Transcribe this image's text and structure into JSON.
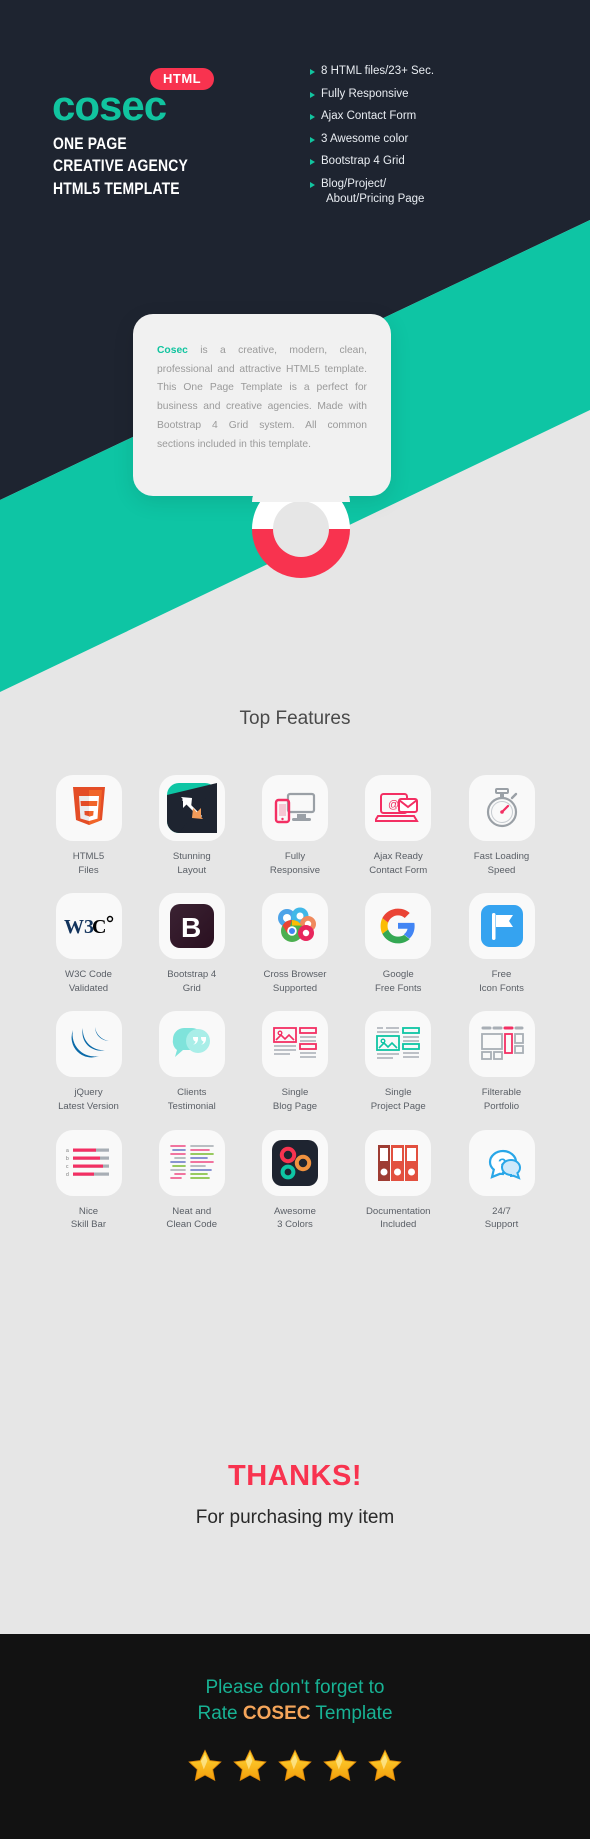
{
  "hero": {
    "badge": "HTML",
    "logo": "cosec",
    "title_lines": [
      "ONE PAGE",
      "CREATIVE AGENCY",
      "HTML5 TEMPLATE"
    ],
    "features": [
      {
        "text": "8 HTML files/23+ Sec.",
        "sub": ""
      },
      {
        "text": "Fully Responsive",
        "sub": ""
      },
      {
        "text": "Ajax Contact Form",
        "sub": ""
      },
      {
        "text": "3 Awesome color",
        "sub": ""
      },
      {
        "text": "Bootstrap 4 Grid",
        "sub": ""
      },
      {
        "text": "Blog/Project/",
        "sub": "About/Pricing Page"
      }
    ]
  },
  "description": {
    "brand": "Cosec",
    "body": " is a creative, modern, clean, professional and attractive HTML5 template. This One Page Template is a perfect for business and creative agencies. Made with Bootstrap 4 Grid system. All common sections included in this template."
  },
  "features_section": {
    "title": "Top Features",
    "rows": [
      [
        {
          "icon": "html5-icon",
          "label": "HTML5\nFiles"
        },
        {
          "icon": "stunning-layout-icon",
          "label": "Stunning\nLayout"
        },
        {
          "icon": "responsive-devices-icon",
          "label": "Fully\nResponsive"
        },
        {
          "icon": "ajax-contact-form-icon",
          "label": "Ajax Ready\nContact Form"
        },
        {
          "icon": "stopwatch-icon",
          "label": "Fast Loading\nSpeed"
        }
      ],
      [
        {
          "icon": "w3c-icon",
          "label": "W3C Code\nValidated"
        },
        {
          "icon": "bootstrap-icon",
          "label": "Bootstrap 4\nGrid"
        },
        {
          "icon": "browsers-icon",
          "label": "Cross Browser\nSupported"
        },
        {
          "icon": "google-icon",
          "label": "Google\nFree Fonts"
        },
        {
          "icon": "flag-icon",
          "label": "Free\nIcon Fonts"
        }
      ],
      [
        {
          "icon": "jquery-icon",
          "label": "jQuery\nLatest Version"
        },
        {
          "icon": "testimonial-chat-icon",
          "label": "Clients\nTestimonial"
        },
        {
          "icon": "blog-page-icon",
          "label": "Single\nBlog Page"
        },
        {
          "icon": "project-page-icon",
          "label": "Single\nProject Page"
        },
        {
          "icon": "portfolio-grid-icon",
          "label": "Filterable\nPortfolio"
        }
      ],
      [
        {
          "icon": "skill-bar-icon",
          "label": "Nice\nSkill Bar"
        },
        {
          "icon": "clean-code-icon",
          "label": "Neat and\nClean Code"
        },
        {
          "icon": "three-colors-icon",
          "label": "Awesome\n3 Colors"
        },
        {
          "icon": "documentation-binders-icon",
          "label": "Documentation\nIncluded"
        },
        {
          "icon": "support-question-icon",
          "label": "24/7\nSupport"
        }
      ]
    ]
  },
  "thanks": {
    "headline": "THANKS!",
    "subline": "For purchasing my item"
  },
  "footer": {
    "line1": "Please don't forget to",
    "line2_prefix": "Rate ",
    "line2_brand": "COSEC",
    "line2_suffix": " Template",
    "star_count": 5
  },
  "colors": {
    "navy": "#1e2430",
    "teal": "#0ec5a4",
    "red": "#f8334f",
    "gray_bg": "#e6e6e6",
    "footer_bg": "#121212",
    "footer_text": "#18b294",
    "footer_brand": "#f5a55a",
    "star": "#f5b51a"
  }
}
